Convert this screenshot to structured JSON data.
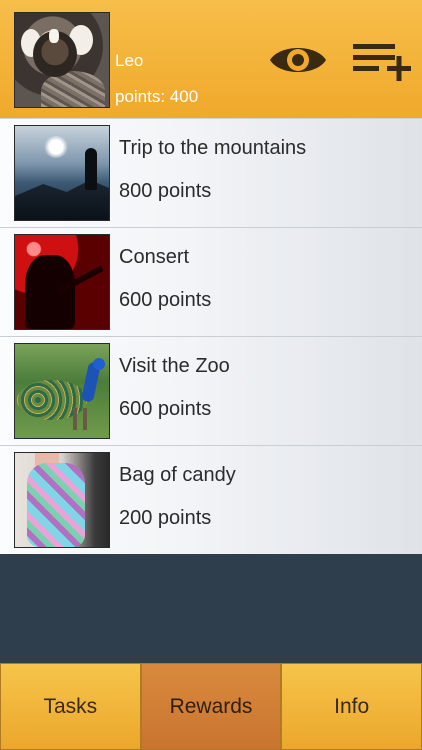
{
  "header": {
    "user_name": "Leo",
    "points_label": "points: 400"
  },
  "icons": {
    "view": "eye-icon",
    "add_list": "playlist-add-icon"
  },
  "rewards": [
    {
      "title": "Trip to the mountains",
      "points": "800 points",
      "image": "mountain-silhouette"
    },
    {
      "title": "Consert",
      "points": "600 points",
      "image": "concert-guitarist"
    },
    {
      "title": "Visit the Zoo",
      "points": "600 points",
      "image": "peacock"
    },
    {
      "title": "Bag of candy",
      "points": "200 points",
      "image": "candy-bag"
    }
  ],
  "tabs": [
    {
      "label": "Tasks",
      "active": false
    },
    {
      "label": "Rewards",
      "active": true
    },
    {
      "label": "Info",
      "active": false
    }
  ],
  "colors": {
    "header": "#f0a92b",
    "tab": "#eba72c",
    "tab_active": "#c97430",
    "background": "#2f3e4c"
  }
}
